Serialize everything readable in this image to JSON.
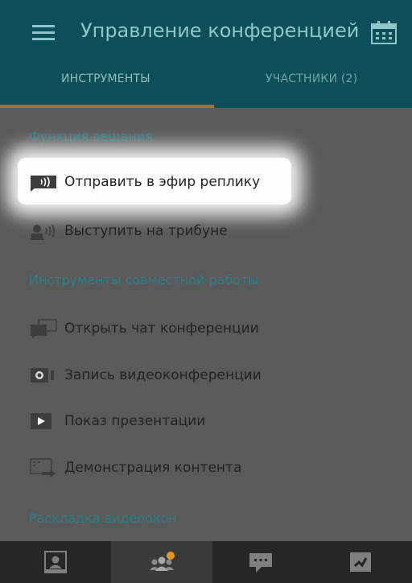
{
  "header": {
    "title": "Управление конференцией",
    "menu_icon": "hamburger-menu-icon",
    "calendar_icon": "calendar-icon"
  },
  "tabs": [
    {
      "label": "ИНСТРУМЕНТЫ",
      "active": true
    },
    {
      "label": "УЧАСТНИКИ (2)",
      "active": false
    }
  ],
  "sections": {
    "broadcast": {
      "title": "Функция вещания",
      "items": [
        {
          "label": "Отправить в эфир реплику",
          "icon": "speech-broadcast-icon",
          "highlighted": true
        },
        {
          "label": "Выступить на трибуне",
          "icon": "speaker-person-icon"
        }
      ]
    },
    "collaboration": {
      "title": "Инструменты совместной работы",
      "items": [
        {
          "label": "Открыть чат конференции",
          "icon": "chat-icon"
        },
        {
          "label": "Запись видеоконференции",
          "icon": "video-record-icon"
        },
        {
          "label": "Показ презентации",
          "icon": "presentation-play-icon"
        },
        {
          "label": "Демонстрация контента",
          "icon": "screen-share-icon"
        }
      ]
    },
    "layout": {
      "title": "Раскладка видеоокон"
    }
  },
  "bottom_bar": [
    {
      "icon": "contacts-icon",
      "active": false
    },
    {
      "icon": "participants-icon",
      "active": true
    },
    {
      "icon": "chat-messages-icon",
      "active": false
    },
    {
      "icon": "call-end-icon",
      "active": false
    }
  ],
  "colors": {
    "header_bg": "#0c4f58",
    "header_text": "#8fc5cc",
    "tab_indicator": "#b36b1f",
    "section_title": "#2b7f88",
    "content_bg": "#5a5a5a",
    "bottom_bar_bg": "#262626",
    "notification_dot": "#e8951f"
  }
}
